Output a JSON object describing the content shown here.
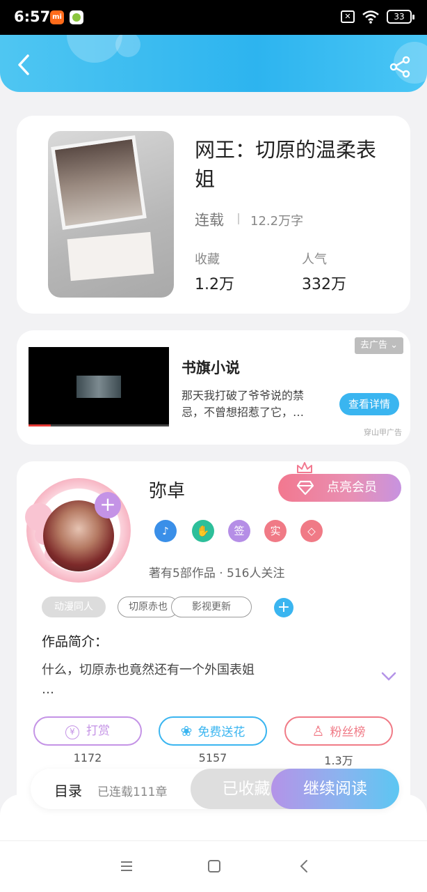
{
  "status_bar": {
    "time": "6:57",
    "app_badge": "mi",
    "sim_icon": "✕",
    "battery": "33"
  },
  "header": {
    "back_icon": "chevron-left-icon",
    "share_icon": "share-icon",
    "colors": {
      "start": "#4fc6f2",
      "end": "#2db4ef"
    }
  },
  "book": {
    "title": "网王：切原的温柔表姐",
    "status": "连载",
    "word_count": "12.2万字",
    "stats": [
      {
        "label": "收藏",
        "value": "1.2万"
      },
      {
        "label": "人气",
        "value": "332万"
      }
    ]
  },
  "ad": {
    "badge": "去广告",
    "title": "书旗小说",
    "description": "那天我打破了爷爷说的禁忌，不曾想招惹了它，…",
    "button": "查看详情",
    "source": "穿山甲广告"
  },
  "author": {
    "name": "弥卓",
    "vip_button": "点亮会员",
    "badges": [
      {
        "name": "music-badge-icon",
        "text": "♪",
        "color": "#3a8fe8"
      },
      {
        "name": "handshake-badge-icon",
        "text": "✋",
        "color": "#2dbf9a"
      },
      {
        "name": "sign-badge-icon",
        "text": "签",
        "color": "#b58ee6"
      },
      {
        "name": "verified-badge-icon",
        "text": "实",
        "color": "#f07a86"
      },
      {
        "name": "diamond-badge-icon",
        "text": "◇",
        "color": "#f07a86"
      }
    ],
    "meta": "著有5部作品 · 516人关注",
    "tags": [
      "动漫同人",
      "切原赤也",
      "影视更新"
    ],
    "intro_title": "作品简介：",
    "intro_text": "什么，切原赤也竟然还有一个外国表姐\n…",
    "actions": [
      {
        "label": "打赏",
        "icon": "¥",
        "count": "1172",
        "color": "#c493e6"
      },
      {
        "label": "免费送花",
        "icon": "❀",
        "count": "5157",
        "color": "#3ab5f0"
      },
      {
        "label": "粉丝榜",
        "icon": "♙",
        "count": "1.3万",
        "color": "#f07a86"
      }
    ]
  },
  "bottom_bar": {
    "toc": "目录",
    "chapters": "已连载111章",
    "collected": "已收藏",
    "read": "继续阅读"
  },
  "nav": {
    "menu_icon": "menu-icon",
    "home_icon": "home-square-icon",
    "back_icon": "back-triangle-icon"
  }
}
